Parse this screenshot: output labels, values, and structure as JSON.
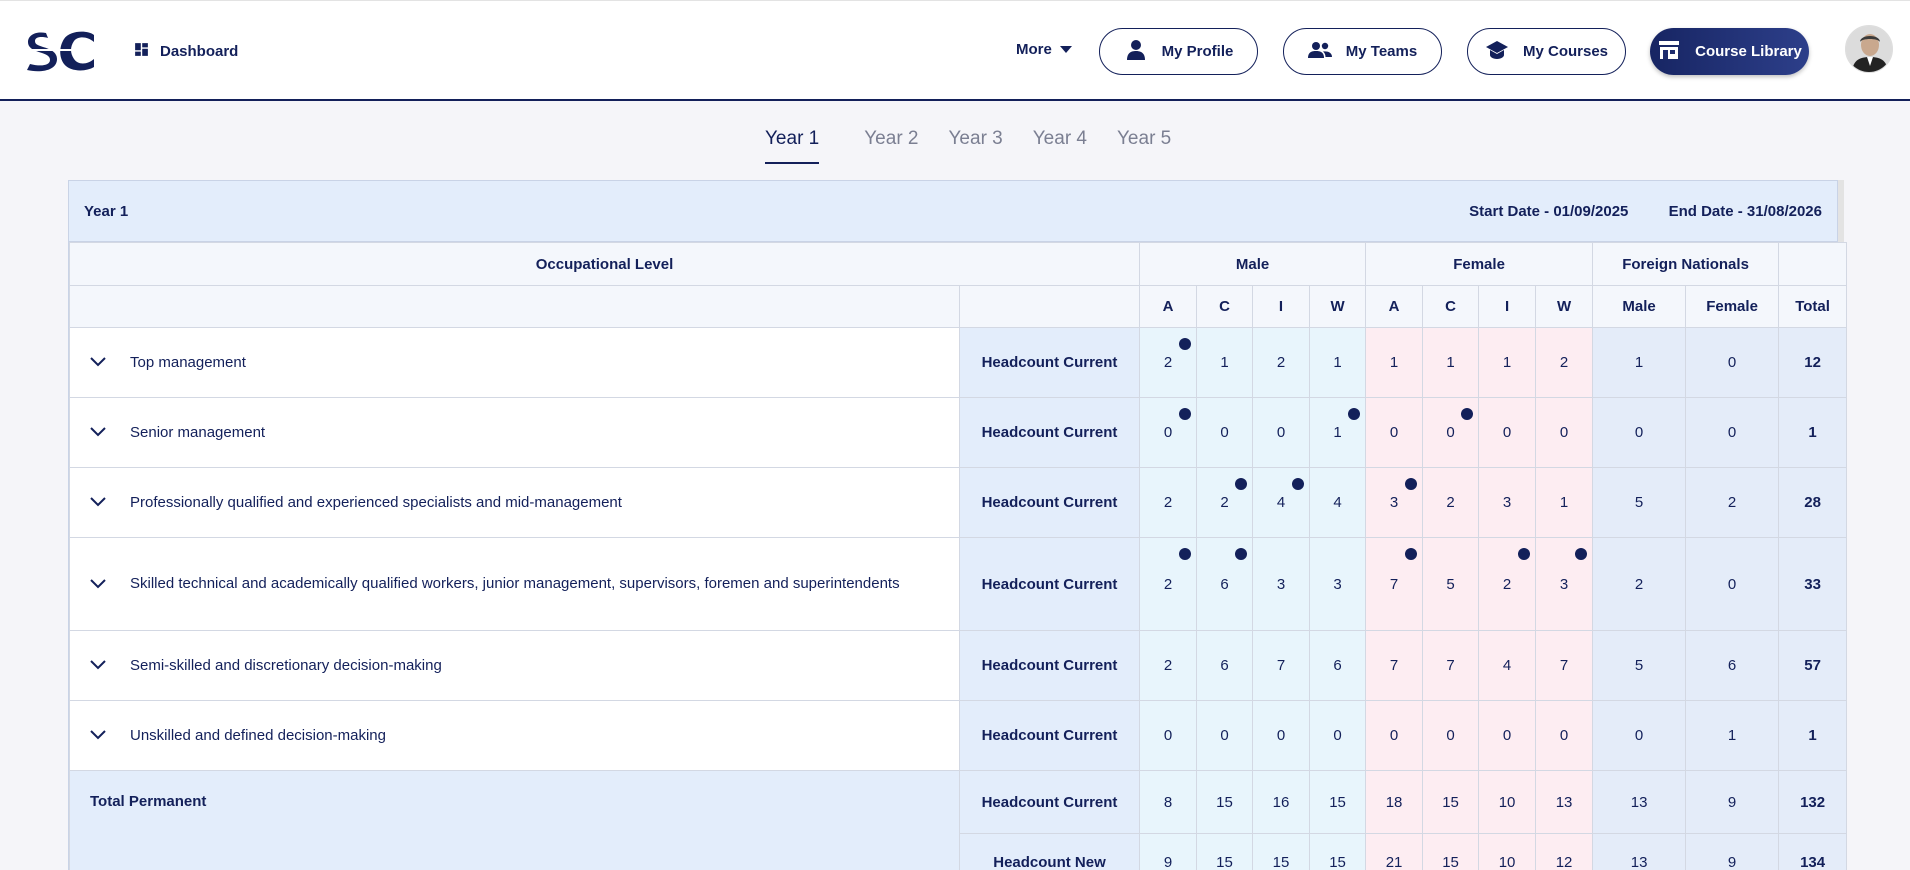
{
  "header": {
    "dashboard_label": "Dashboard",
    "more_label": "More",
    "nav": [
      {
        "label": "My Profile",
        "icon": "person-icon"
      },
      {
        "label": "My Teams",
        "icon": "people-icon"
      },
      {
        "label": "My Courses",
        "icon": "graduation-cap-icon"
      },
      {
        "label": "Course Library",
        "icon": "store-icon"
      }
    ],
    "accent_color": "#13205a"
  },
  "tabs": [
    "Year 1",
    "Year 2",
    "Year 3",
    "Year 4",
    "Year 5"
  ],
  "active_tab": "Year 1",
  "card": {
    "title": "Year 1",
    "start_date": "Start Date - 01/09/2025",
    "end_date": "End Date - 31/08/2026"
  },
  "table": {
    "group_headers": {
      "occupational": "Occupational Level",
      "male": "Male",
      "female": "Female",
      "foreign": "Foreign Nationals"
    },
    "sub_headers": [
      "A",
      "C",
      "I",
      "W",
      "A",
      "C",
      "I",
      "W",
      "Male",
      "Female",
      "Total"
    ],
    "rows": [
      {
        "level": "Top management",
        "measure": "Headcount Current",
        "values": [
          "2",
          "1",
          "2",
          "1",
          "1",
          "1",
          "1",
          "2",
          "1",
          "0",
          "12"
        ]
      },
      {
        "level": "Senior management",
        "measure": "Headcount Current",
        "values": [
          "0",
          "0",
          "0",
          "1",
          "0",
          "0",
          "0",
          "0",
          "0",
          "0",
          "1"
        ]
      },
      {
        "level": "Professionally qualified and experienced specialists and mid-management",
        "measure": "Headcount Current",
        "values": [
          "2",
          "2",
          "4",
          "4",
          "3",
          "2",
          "3",
          "1",
          "5",
          "2",
          "28"
        ]
      },
      {
        "level": "Skilled technical and academically qualified workers, junior management, supervisors, foremen and superintendents",
        "measure": "Headcount Current",
        "values": [
          "2",
          "6",
          "3",
          "3",
          "7",
          "5",
          "2",
          "3",
          "2",
          "0",
          "33"
        ]
      },
      {
        "level": "Semi-skilled and discretionary decision-making",
        "measure": "Headcount Current",
        "values": [
          "2",
          "6",
          "7",
          "6",
          "7",
          "7",
          "4",
          "7",
          "5",
          "6",
          "57"
        ]
      },
      {
        "level": "Unskilled and defined decision-making",
        "measure": "Headcount Current",
        "values": [
          "0",
          "0",
          "0",
          "0",
          "0",
          "0",
          "0",
          "0",
          "0",
          "1",
          "1"
        ]
      }
    ],
    "total_permanent": {
      "label": "Total Permanent",
      "rows": [
        {
          "measure": "Headcount Current",
          "values": [
            "8",
            "15",
            "16",
            "15",
            "18",
            "15",
            "10",
            "13",
            "13",
            "9",
            "132"
          ]
        },
        {
          "measure": "Headcount New",
          "values": [
            "9",
            "15",
            "15",
            "15",
            "21",
            "15",
            "10",
            "12",
            "13",
            "9",
            "134"
          ]
        }
      ]
    },
    "dot_markers": [
      [
        0
      ],
      [
        0,
        3,
        5
      ],
      [
        1,
        2,
        4
      ],
      [
        0,
        1,
        4,
        6,
        7
      ],
      [],
      []
    ]
  }
}
